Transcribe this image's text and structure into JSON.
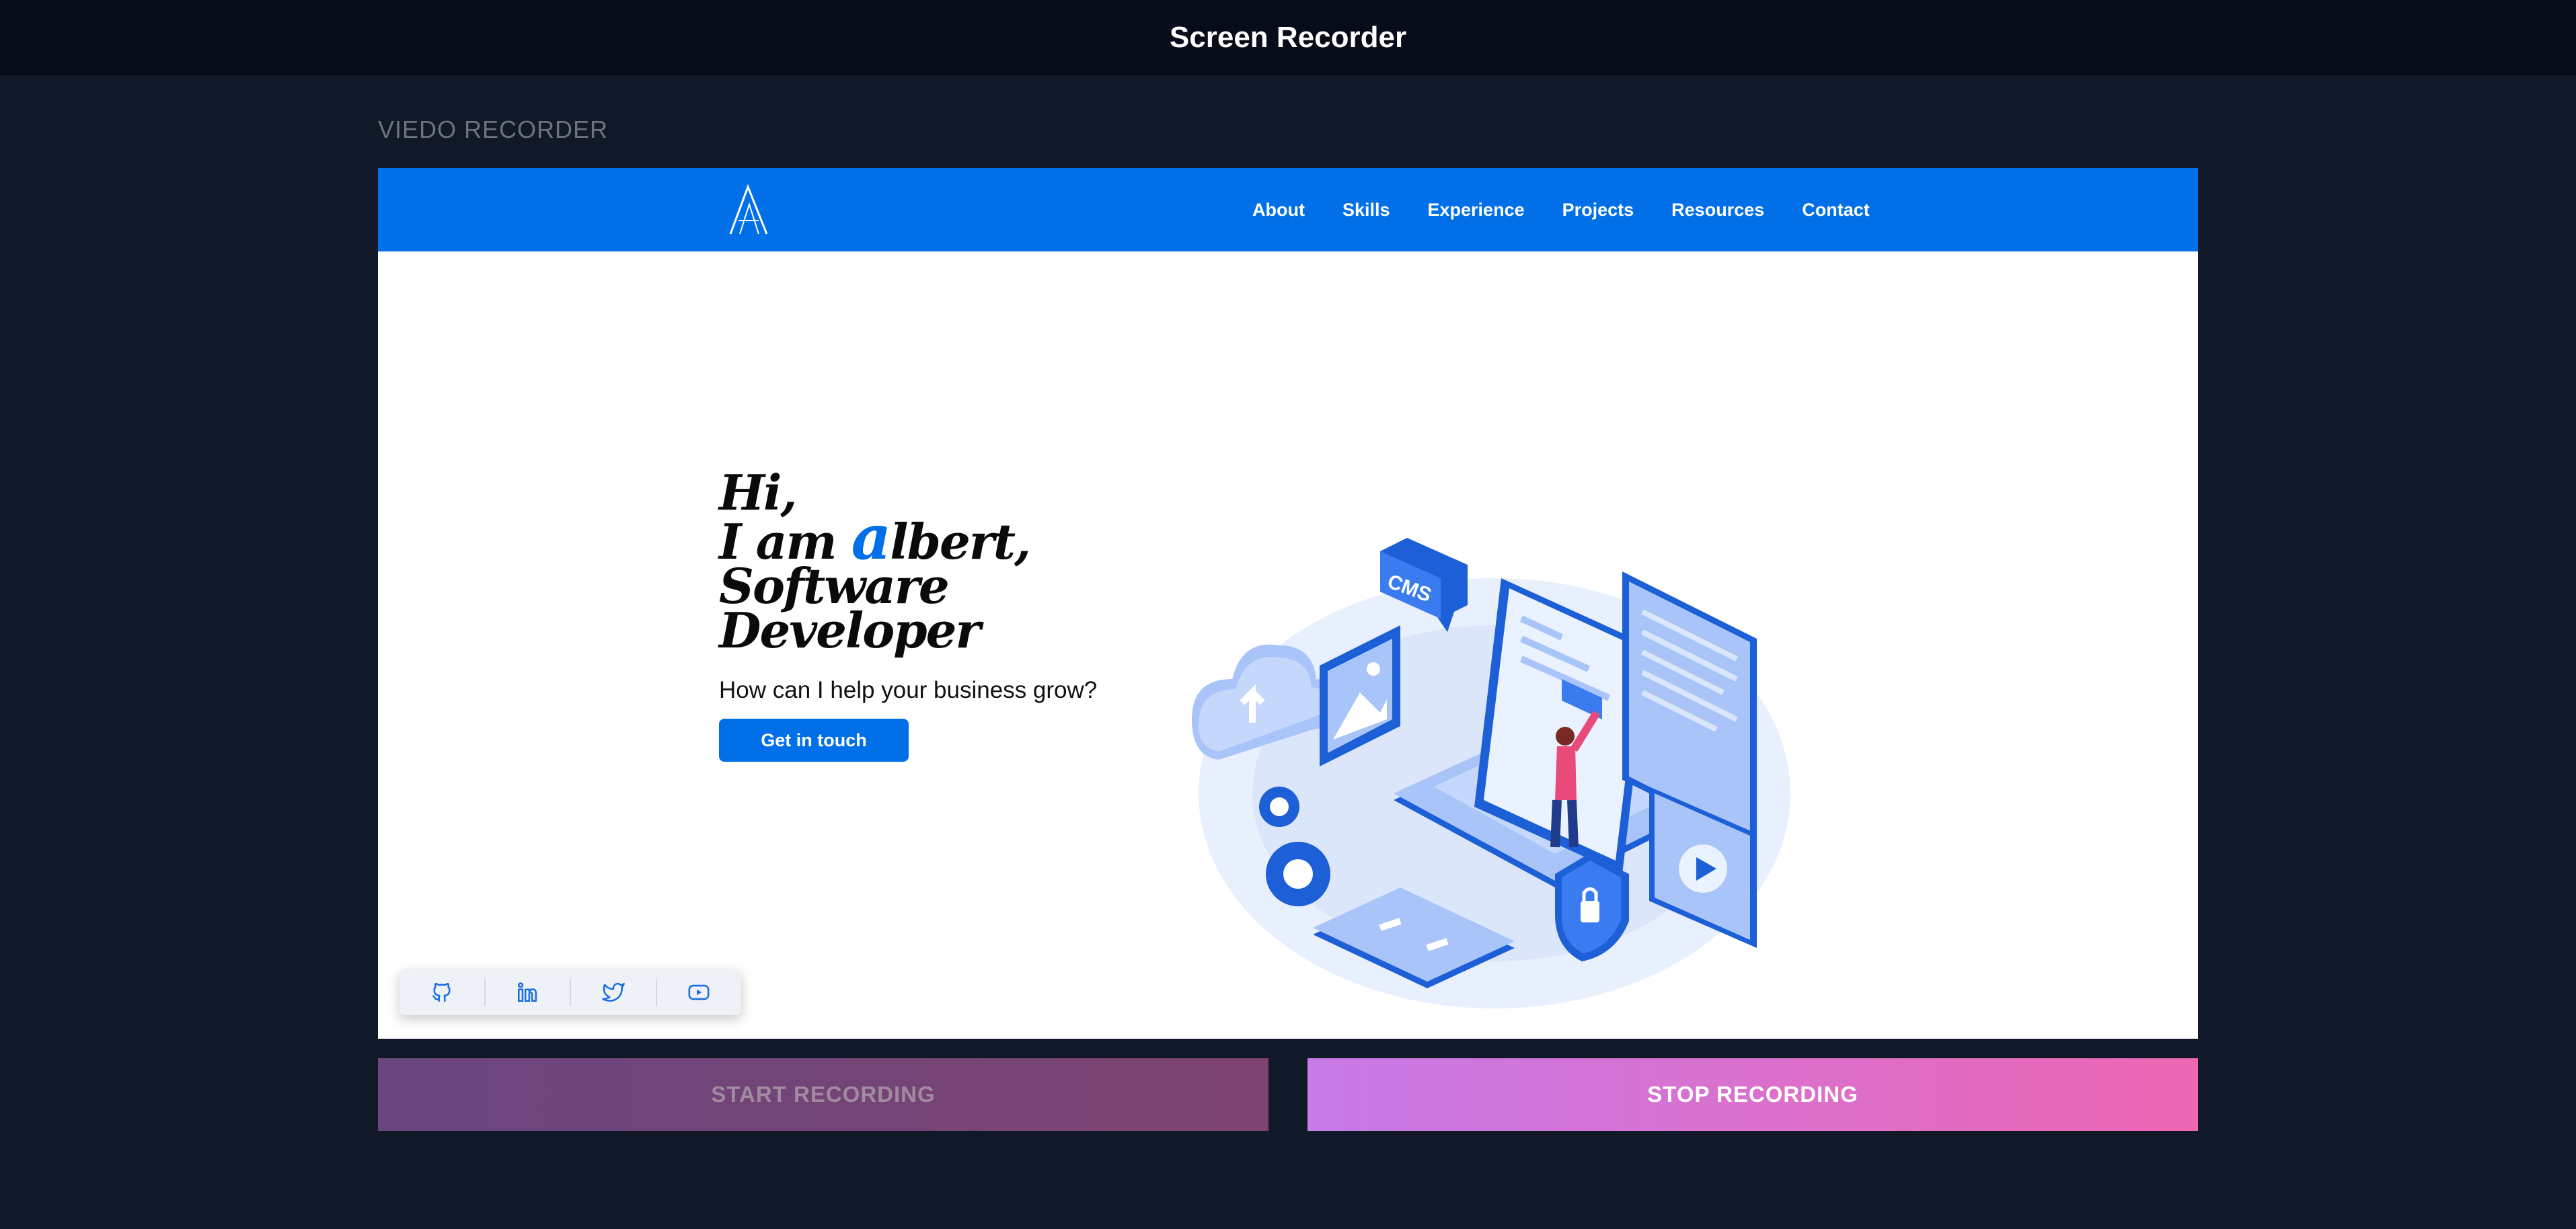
{
  "app": {
    "title": "Screen Recorder"
  },
  "section": {
    "label": "VIEDO RECORDER"
  },
  "preview": {
    "nav": {
      "logo_icon": "A-monogram-logo",
      "links": [
        "About",
        "Skills",
        "Experience",
        "Projects",
        "Resources",
        "Contact"
      ]
    },
    "hero": {
      "line1": "Hi,",
      "line2_pre": "I am ",
      "line2_accent": "a",
      "line2_post": "lbert,",
      "line3": "Software Developer",
      "subtitle": "How can I help your business grow?",
      "cta_label": "Get in touch",
      "illustration_label": "CMS"
    },
    "social": [
      {
        "name": "github-icon"
      },
      {
        "name": "linkedin-icon"
      },
      {
        "name": "twitter-icon"
      },
      {
        "name": "youtube-icon"
      }
    ]
  },
  "controls": {
    "start_label": "START RECORDING",
    "stop_label": "STOP RECORDING"
  },
  "colors": {
    "page_bg": "#111827",
    "topbar_bg": "#070c1a",
    "accent": "#0170e8",
    "start_gradient": [
      "#69467e",
      "#7d4370"
    ],
    "stop_gradient": [
      "#c77ae8",
      "#ed67b3"
    ]
  }
}
